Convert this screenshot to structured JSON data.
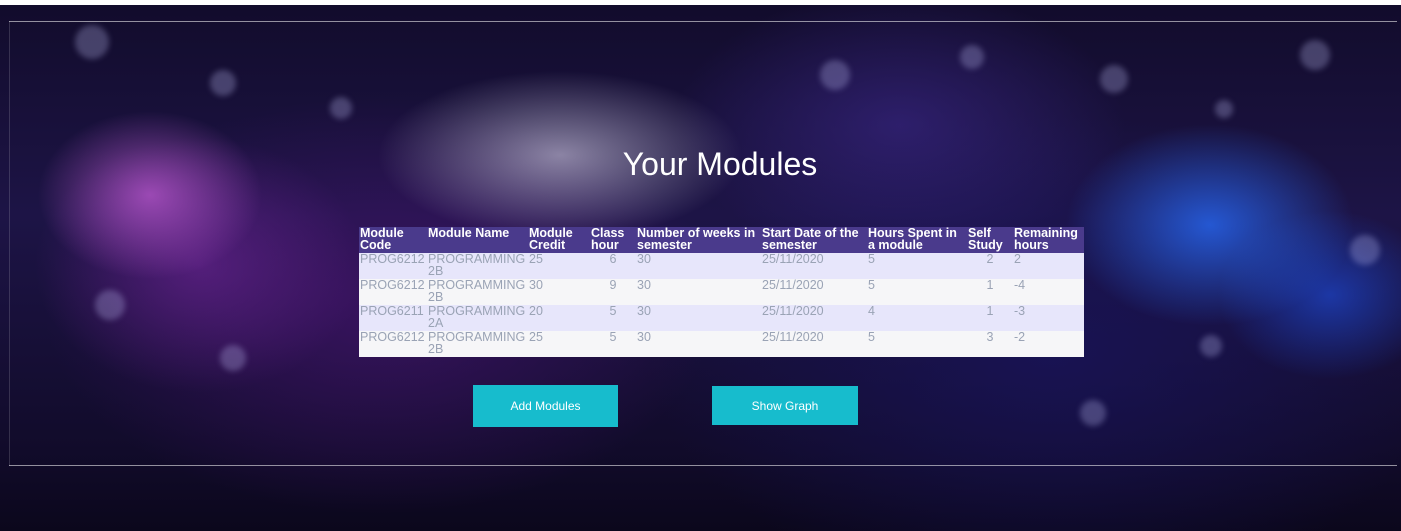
{
  "page": {
    "heading": "Your Modules"
  },
  "table": {
    "columns": [
      "Module Code",
      "Module Name",
      "Module Credit",
      "Class hour",
      "Number of weeks in semester",
      "Start Date of the semester",
      "Hours Spent in a module",
      "Self Study",
      "Remaining hours"
    ],
    "rows": [
      [
        "PROG6212",
        "PROGRAMMING 2B",
        "25",
        "6",
        "30",
        "25/11/2020",
        "5",
        "2",
        "2"
      ],
      [
        "PROG6212",
        "PROGRAMMING 2B",
        "30",
        "9",
        "30",
        "25/11/2020",
        "5",
        "1",
        "-4"
      ],
      [
        "PROG6211",
        "PROGRAMMING 2A",
        "20",
        "5",
        "30",
        "25/11/2020",
        "4",
        "1",
        "-3"
      ],
      [
        "PROG6212",
        "PROGRAMMING 2B",
        "25",
        "5",
        "30",
        "25/11/2020",
        "5",
        "3",
        "-2"
      ]
    ]
  },
  "buttons": {
    "add_modules": "Add Modules",
    "show_graph": "Show Graph"
  },
  "colors": {
    "header_bg": "#4a3a8c",
    "row_odd": "#e7e6fb",
    "row_even": "#f6f6f8",
    "button": "#17bccd"
  }
}
